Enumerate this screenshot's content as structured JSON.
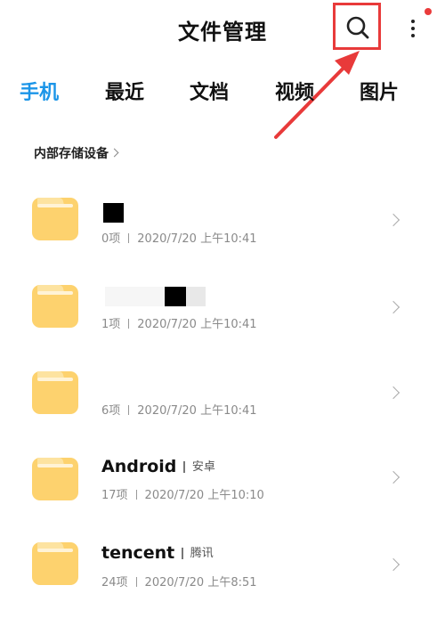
{
  "header": {
    "title": "文件管理",
    "accent_color": "#1b95e8",
    "highlight_color": "#e83a3a",
    "search_icon": "search-icon",
    "more_icon": "more-vertical-icon"
  },
  "tabs": [
    {
      "label": "手机",
      "active": true
    },
    {
      "label": "最近",
      "active": false
    },
    {
      "label": "文档",
      "active": false
    },
    {
      "label": "视频",
      "active": false
    },
    {
      "label": "图片",
      "active": false
    }
  ],
  "breadcrumb": {
    "label": "内部存储设备"
  },
  "folders": [
    {
      "name": "",
      "alias": "",
      "count": "0项",
      "date": "2020/7/20 上午10:41"
    },
    {
      "name": "",
      "alias": "",
      "count": "1项",
      "date": "2020/7/20 上午10:41"
    },
    {
      "name": "",
      "alias": "",
      "count": "6项",
      "date": "2020/7/20 上午10:41"
    },
    {
      "name": "Android",
      "alias": "安卓",
      "count": "17项",
      "date": "2020/7/20 上午10:10"
    },
    {
      "name": "tencent",
      "alias": "腾讯",
      "count": "24项",
      "date": "2020/7/20 上午8:51"
    }
  ]
}
